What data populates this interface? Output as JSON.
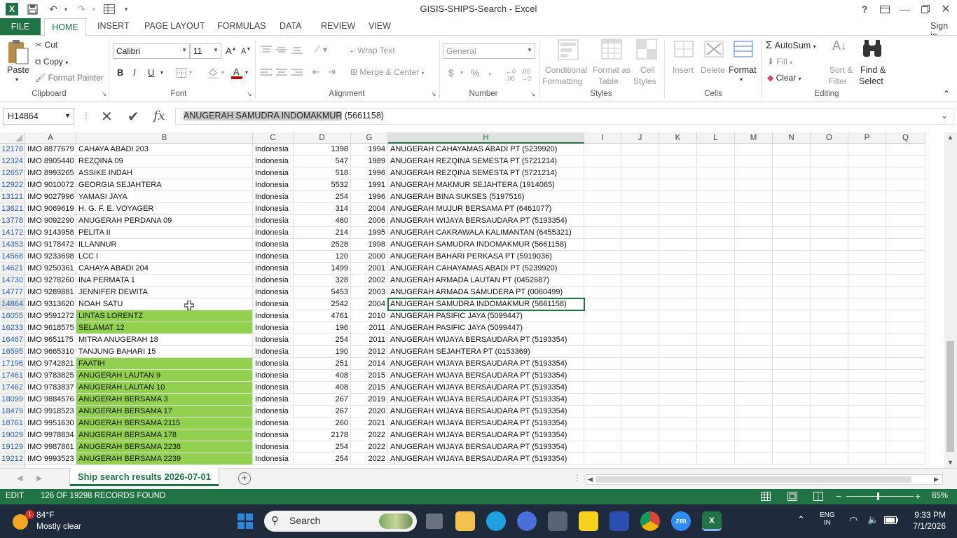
{
  "window": {
    "title": "GISIS-SHIPS-Search - Excel",
    "sign_in": "Sign in",
    "help": "?"
  },
  "tabs": {
    "file": "FILE",
    "home": "HOME",
    "insert": "INSERT",
    "page_layout": "PAGE LAYOUT",
    "formulas": "FORMULAS",
    "data": "DATA",
    "review": "REVIEW",
    "view": "VIEW"
  },
  "ribbon": {
    "clipboard": {
      "label": "Clipboard",
      "paste": "Paste",
      "cut": "Cut",
      "copy": "Copy",
      "format_painter": "Format Painter"
    },
    "font": {
      "label": "Font",
      "name": "Calibri",
      "size": "11",
      "bold": "B",
      "italic": "I",
      "underline": "U"
    },
    "alignment": {
      "label": "Alignment",
      "wrap_text": "Wrap Text",
      "merge_center": "Merge & Center"
    },
    "number": {
      "label": "Number",
      "format": "General",
      "currency": "$",
      "percent": "%",
      "comma": ","
    },
    "styles": {
      "label": "Styles",
      "conditional_1": "Conditional",
      "conditional_2": "Formatting",
      "format_table_1": "Format as",
      "format_table_2": "Table",
      "cell_styles_1": "Cell",
      "cell_styles_2": "Styles"
    },
    "cells": {
      "label": "Cells",
      "insert": "Insert",
      "delete": "Delete",
      "format": "Format"
    },
    "editing": {
      "label": "Editing",
      "autosum": "AutoSum",
      "fill": "Fill",
      "clear": "Clear",
      "sort_1": "Sort &",
      "sort_2": "Filter",
      "find_1": "Find &",
      "find_2": "Select"
    }
  },
  "formula_bar": {
    "name_box": "H14864",
    "fx": "fx",
    "value_selected": "ANUGERAH SAMUDRA INDOMAKMUR",
    "value_rest": " (5661158)"
  },
  "columns": [
    "A",
    "B",
    "C",
    "D",
    "G",
    "H",
    "I",
    "J",
    "K",
    "L",
    "M",
    "N",
    "O",
    "P",
    "Q"
  ],
  "rows": [
    {
      "row": "12178",
      "a": "IMO 8877679",
      "b": "CAHAYA ABADI 203",
      "c": "Indonesia",
      "d": "1398",
      "g": "1994",
      "h": "ANUGERAH CAHAYAMAS ABADI PT (5239920)",
      "green": false
    },
    {
      "row": "12324",
      "a": "IMO 8905440",
      "b": "REZQINA 09",
      "c": "Indonesia",
      "d": "547",
      "g": "1989",
      "h": "ANUGERAH REZQINA SEMESTA PT (5721214)",
      "green": false
    },
    {
      "row": "12657",
      "a": "IMO 8993265",
      "b": "ASSIKE INDAH",
      "c": "Indonesia",
      "d": "518",
      "g": "1996",
      "h": "ANUGERAH REZQINA SEMESTA PT (5721214)",
      "green": false
    },
    {
      "row": "12922",
      "a": "IMO 9010072",
      "b": "GEORGIA SEJAHTERA",
      "c": "Indonesia",
      "d": "5532",
      "g": "1991",
      "h": "ANUGERAH MAKMUR SEJAHTERA (1914065)",
      "green": false
    },
    {
      "row": "13121",
      "a": "IMO 9027996",
      "b": "YAMASI JAYA",
      "c": "Indonesia",
      "d": "254",
      "g": "1996",
      "h": "ANUGERAH BINA SUKSES (5197516)",
      "green": false
    },
    {
      "row": "13621",
      "a": "IMO 9069619",
      "b": "H. G. F. E. VOYAGER",
      "c": "Indonesia",
      "d": "314",
      "g": "2004",
      "h": "ANUGERAH MUJUR BERSAMA PT (6461077)",
      "green": false
    },
    {
      "row": "13778",
      "a": "IMO 9092290",
      "b": "ANUGERAH PERDANA 09",
      "c": "Indonesia",
      "d": "460",
      "g": "2006",
      "h": "ANUGERAH WIJAYA BERSAUDARA PT (5193354)",
      "green": false
    },
    {
      "row": "14172",
      "a": "IMO 9143958",
      "b": "PELITA II",
      "c": "Indonesia",
      "d": "214",
      "g": "1995",
      "h": "ANUGERAH CAKRAWALA KALIMANTAN (6455321)",
      "green": false
    },
    {
      "row": "14353",
      "a": "IMO 9178472",
      "b": "ILLANNUR",
      "c": "Indonesia",
      "d": "2528",
      "g": "1998",
      "h": "ANUGERAH SAMUDRA INDOMAKMUR (5661158)",
      "green": false
    },
    {
      "row": "14568",
      "a": "IMO 9233698",
      "b": "LCC I",
      "c": "Indonesia",
      "d": "120",
      "g": "2000",
      "h": "ANUGERAH BAHARI PERKASA PT (5919036)",
      "green": false
    },
    {
      "row": "14621",
      "a": "IMO 9250361",
      "b": "CAHAYA ABADI 204",
      "c": "Indonesia",
      "d": "1499",
      "g": "2001",
      "h": "ANUGERAH CAHAYAMAS ABADI PT (5239920)",
      "green": false
    },
    {
      "row": "14730",
      "a": "IMO 9278260",
      "b": "INA PERMATA 1",
      "c": "Indonesia",
      "d": "328",
      "g": "2002",
      "h": "ANUGERAH ARMADA LAUTAN PT (0452687)",
      "green": false
    },
    {
      "row": "14777",
      "a": "IMO 9289881",
      "b": "JENNIFER DEWITA",
      "c": "Indonesia",
      "d": "5453",
      "g": "2003",
      "h": "ANUGERAH ARMADA SAMUDERA PT (0060499)",
      "green": false
    },
    {
      "row": "14864",
      "a": "IMO 9313620",
      "b": "NOAH SATU",
      "c": "Indonesia",
      "d": "2542",
      "g": "2004",
      "h": "ANUGERAH SAMUDRA INDOMAKMUR (5661158)",
      "green": false
    },
    {
      "row": "16055",
      "a": "IMO 9591272",
      "b": "LINTAS LORENTZ",
      "c": "Indonesia",
      "d": "4761",
      "g": "2010",
      "h": "ANUGERAH PASIFIC JAYA (5099447)",
      "green": true
    },
    {
      "row": "16233",
      "a": "IMO 9618575",
      "b": "SELAMAT 12",
      "c": "Indonesia",
      "d": "196",
      "g": "2011",
      "h": "ANUGERAH PASIFIC JAYA (5099447)",
      "green": true
    },
    {
      "row": "16467",
      "a": "IMO 9651175",
      "b": "MITRA ANUGERAH 18",
      "c": "Indonesia",
      "d": "254",
      "g": "2011",
      "h": "ANUGERAH WIJAYA BERSAUDARA PT (5193354)",
      "green": false
    },
    {
      "row": "16595",
      "a": "IMO 9665310",
      "b": "TANJUNG BAHARI 15",
      "c": "Indonesia",
      "d": "190",
      "g": "2012",
      "h": "ANUGERAH SEJAHTERA PT (0153369)",
      "green": false
    },
    {
      "row": "17196",
      "a": "IMO 9742821",
      "b": "FAATIH",
      "c": "Indonesia",
      "d": "251",
      "g": "2014",
      "h": "ANUGERAH WIJAYA BERSAUDARA PT (5193354)",
      "green": true
    },
    {
      "row": "17461",
      "a": "IMO 9783825",
      "b": "ANUGERAH LAUTAN 9",
      "c": "Indonesia",
      "d": "408",
      "g": "2015",
      "h": "ANUGERAH WIJAYA BERSAUDARA PT (5193354)",
      "green": true
    },
    {
      "row": "17462",
      "a": "IMO 9783837",
      "b": "ANUGERAH LAUTAN 10",
      "c": "Indonesia",
      "d": "408",
      "g": "2015",
      "h": "ANUGERAH WIJAYA BERSAUDARA PT (5193354)",
      "green": true
    },
    {
      "row": "18099",
      "a": "IMO 9884576",
      "b": "ANUGERAH BERSAMA 3",
      "c": "Indonesia",
      "d": "267",
      "g": "2019",
      "h": "ANUGERAH WIJAYA BERSAUDARA PT (5193354)",
      "green": true
    },
    {
      "row": "18479",
      "a": "IMO 9918523",
      "b": "ANUGERAH BERSAMA 17",
      "c": "Indonesia",
      "d": "267",
      "g": "2020",
      "h": "ANUGERAH WIJAYA BERSAUDARA PT (5193354)",
      "green": true
    },
    {
      "row": "18761",
      "a": "IMO 9951630",
      "b": "ANUGERAH BERSAMA 2115",
      "c": "Indonesia",
      "d": "260",
      "g": "2021",
      "h": "ANUGERAH WIJAYA BERSAUDARA PT (5193354)",
      "green": true
    },
    {
      "row": "19029",
      "a": "IMO 9978834",
      "b": "ANUGERAH BERSAMA 178",
      "c": "Indonesia",
      "d": "2178",
      "g": "2022",
      "h": "ANUGERAH WIJAYA BERSAUDARA PT (5193354)",
      "green": true
    },
    {
      "row": "19129",
      "a": "IMO 9987861",
      "b": "ANUGERAH BERSAMA 2238",
      "c": "Indonesia",
      "d": "254",
      "g": "2022",
      "h": "ANUGERAH WIJAYA BERSAUDARA PT (5193354)",
      "green": true
    },
    {
      "row": "19212",
      "a": "IMO 9993523",
      "b": "ANUGERAH BERSAMA 2239",
      "c": "Indonesia",
      "d": "254",
      "g": "2022",
      "h": "ANUGERAH WIJAYA BERSAUDARA PT (5193354)",
      "green": true
    }
  ],
  "active_row": "14864",
  "sheet": {
    "tab_name": "Ship search results 2026-07-01"
  },
  "status": {
    "mode": "EDIT",
    "message": "126 OF 19298 RECORDS FOUND",
    "zoom": "85%"
  },
  "taskbar": {
    "temperature": "84°F",
    "weather": "Mostly clear",
    "weather_badge": "1",
    "search_placeholder": "Search",
    "lang": "ENG",
    "lang_sub": "IN",
    "time": "9:33 PM",
    "date": "7/1/2026",
    "zoom_app": "zm"
  },
  "colors": {
    "excel_green": "#217346",
    "highlight_green": "#92d050",
    "taskbar": "#1f2a3c"
  }
}
